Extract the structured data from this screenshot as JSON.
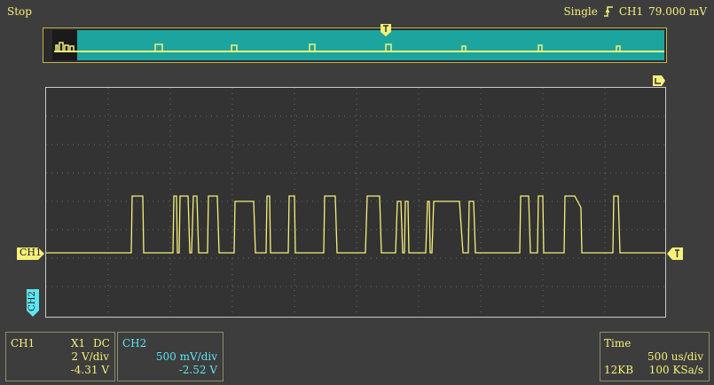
{
  "status": {
    "run_state": "Stop",
    "mode": "Single",
    "trigger_source": "CH1",
    "trigger_level": "79.000 mV"
  },
  "markers": {
    "ch1_label": "CH1",
    "ch2_label": "CH2",
    "trigger_pos_icon": "trigger-position-icon",
    "ch1_level_icon": "trigger-level-icon"
  },
  "ch1_panel": {
    "name": "CH1",
    "probe": "X1",
    "coupling": "DC",
    "scale": "2 V/div",
    "offset": "-4.31 V"
  },
  "ch2_panel": {
    "name": "CH2",
    "scale": "500 mV/div",
    "offset": "-2.52 V"
  },
  "time_panel": {
    "title": "Time",
    "timebase": "500 us/div",
    "memory": "12KB",
    "sample_rate": "100 KSa/s"
  },
  "colors": {
    "ch1": "#f5f07a",
    "ch2": "#5fe5f2",
    "overview_bg": "#1ba59e"
  }
}
